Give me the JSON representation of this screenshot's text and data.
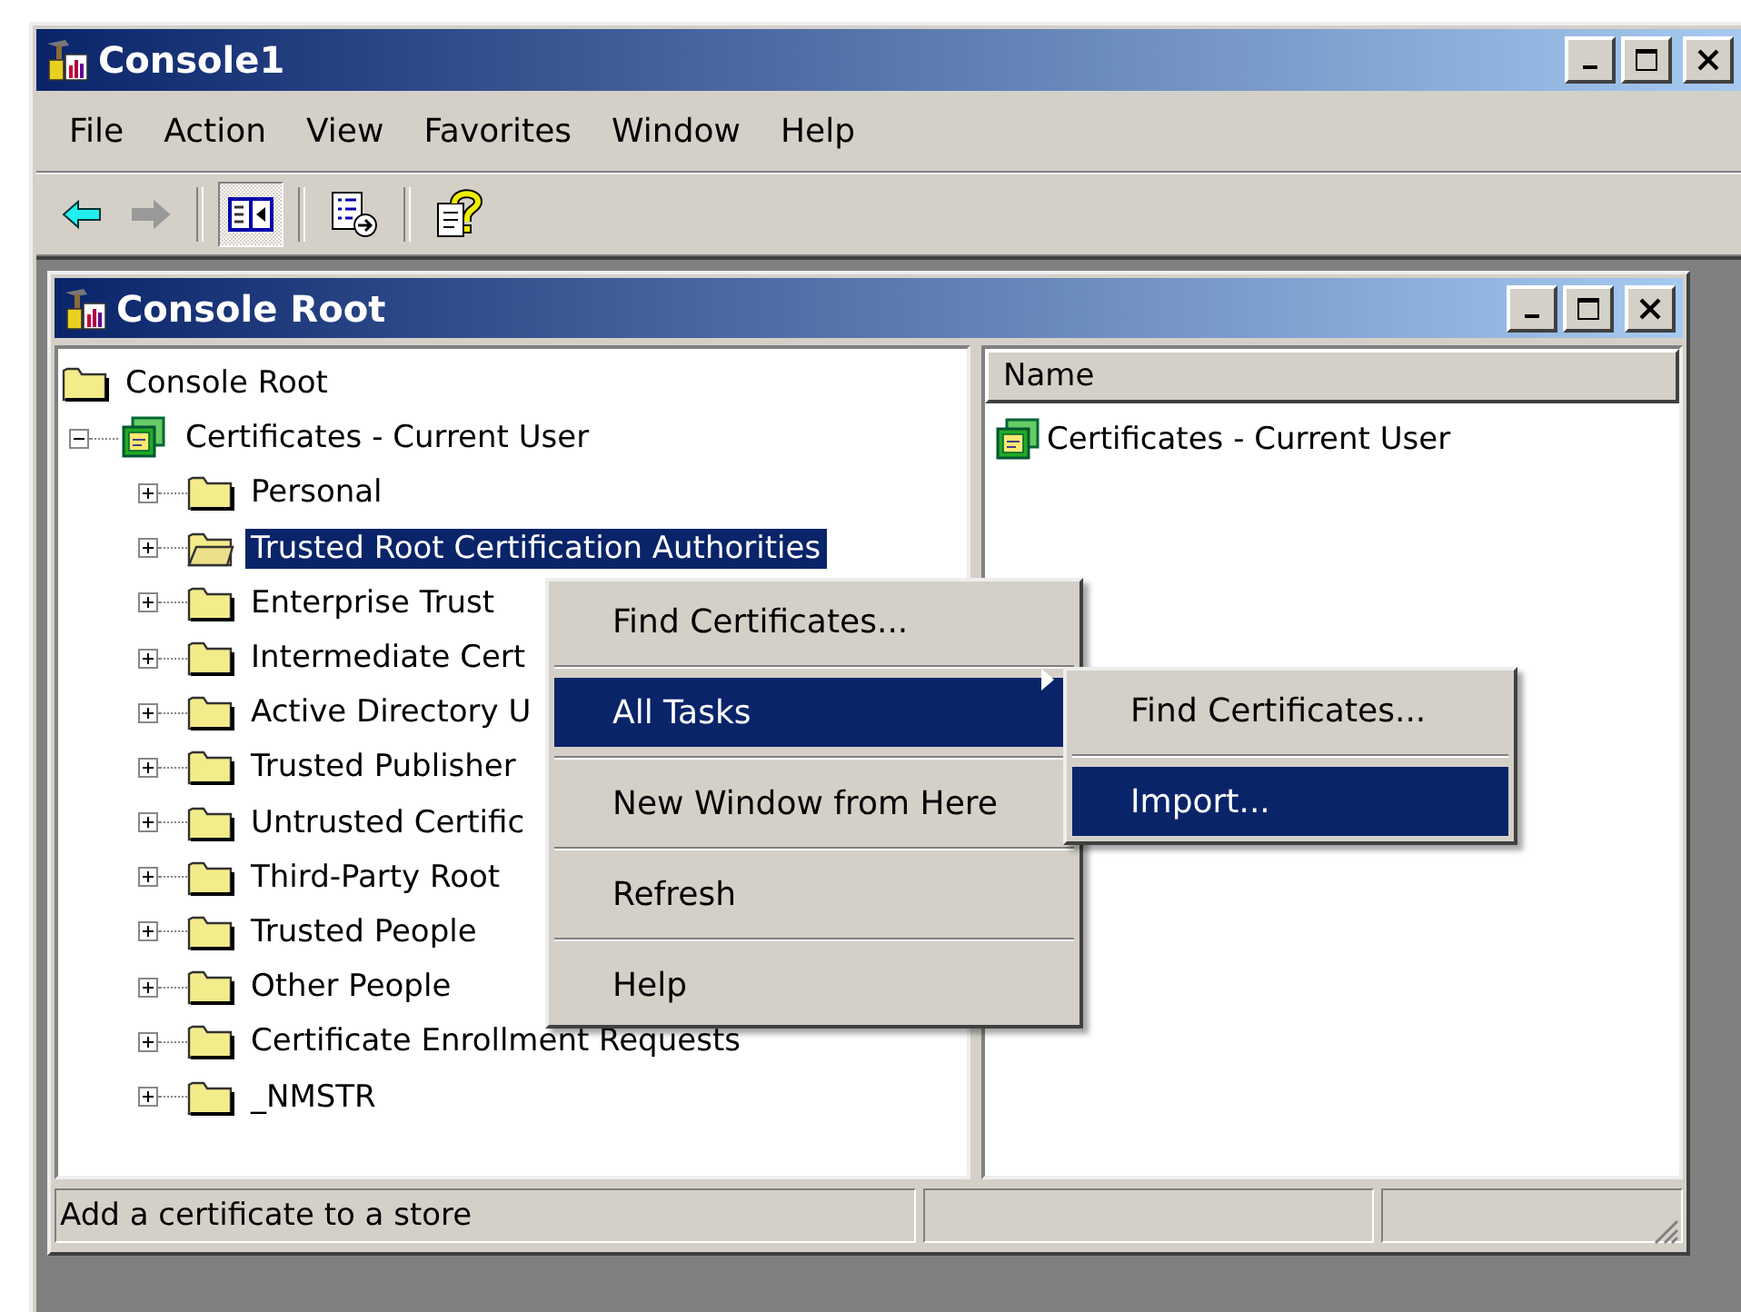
{
  "window": {
    "title": "Console1"
  },
  "menu_bar": [
    "File",
    "Action",
    "View",
    "Favorites",
    "Window",
    "Help"
  ],
  "toolbar": [
    {
      "kind": "back",
      "disabled": false
    },
    {
      "kind": "forward",
      "disabled": true
    },
    {
      "kind": "separator"
    },
    {
      "kind": "tree-toggle",
      "on": true
    },
    {
      "kind": "separator"
    },
    {
      "kind": "export"
    },
    {
      "kind": "separator"
    },
    {
      "kind": "help"
    }
  ],
  "child_window": {
    "title": "Console Root",
    "tree": [
      {
        "label": "Console Root",
        "selected": false,
        "children": [
          {
            "label": "Certificates - Current User",
            "expanded": true,
            "selected": false,
            "children": [
              {
                "label": "Personal",
                "expanded": false,
                "selected": false
              },
              {
                "label": "Trusted Root Certification Authorities",
                "expanded": false,
                "selected": true
              },
              {
                "label": "Enterprise Trust",
                "expanded": false,
                "selected": false
              },
              {
                "label": "Intermediate Cert",
                "expanded": false,
                "selected": false
              },
              {
                "label": "Active Directory U",
                "expanded": false,
                "selected": false
              },
              {
                "label": "Trusted Publisher",
                "expanded": false,
                "selected": false
              },
              {
                "label": "Untrusted Certific",
                "expanded": false,
                "selected": false
              },
              {
                "label": "Third-Party Root",
                "expanded": false,
                "selected": false
              },
              {
                "label": "Trusted People",
                "expanded": false,
                "selected": false
              },
              {
                "label": "Other People",
                "expanded": false,
                "selected": false
              },
              {
                "label": "Certificate Enrollment Requests",
                "expanded": false,
                "selected": false
              },
              {
                "label": "_NMSTR",
                "expanded": false,
                "selected": false
              }
            ]
          }
        ]
      }
    ],
    "list": {
      "columns": [
        "Name"
      ],
      "rows": [
        {
          "name": "Certificates - Current User"
        }
      ]
    },
    "status_bar": [
      "Add a certificate to a store"
    ]
  },
  "context_menu": [
    {
      "kind": "item",
      "label": "Find Certificates...",
      "selected": false
    },
    {
      "kind": "separator"
    },
    {
      "kind": "submenu",
      "label": "All Tasks",
      "selected": true
    },
    {
      "kind": "separator"
    },
    {
      "kind": "item",
      "label": "New Window from Here",
      "selected": false
    },
    {
      "kind": "separator"
    },
    {
      "kind": "item",
      "label": "Refresh",
      "selected": false
    },
    {
      "kind": "separator"
    },
    {
      "kind": "item",
      "label": "Help",
      "selected": false
    }
  ],
  "submenu": [
    {
      "kind": "item",
      "label": "Find Certificates...",
      "selected": false
    },
    {
      "kind": "separator"
    },
    {
      "kind": "item",
      "label": "Import...",
      "selected": true
    }
  ]
}
